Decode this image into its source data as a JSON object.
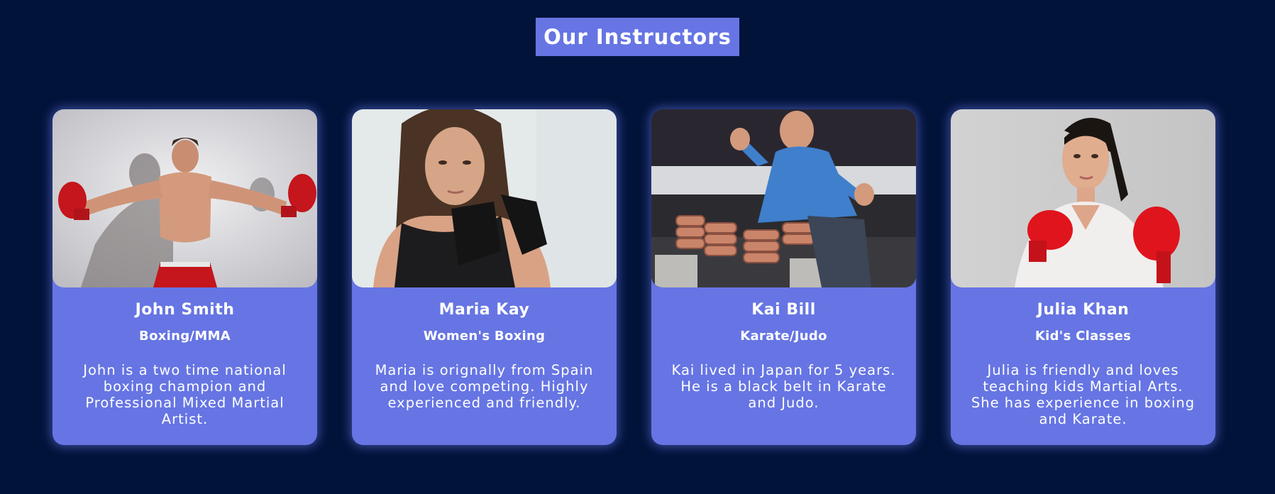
{
  "section": {
    "title": "Our Instructors"
  },
  "instructors": [
    {
      "name": "John Smith",
      "role": "Boxing/MMA",
      "bio": "John is a two time national boxing champion and Professional Mixed Martial Artist."
    },
    {
      "name": "Maria Kay",
      "role": "Women's Boxing",
      "bio": "Maria is orignally from Spain and love competing. Highly experienced and friendly."
    },
    {
      "name": "Kai Bill",
      "role": "Karate/Judo",
      "bio": "Kai lived in Japan for 5 years. He is a black belt in Karate and Judo."
    },
    {
      "name": "Julia Khan",
      "role": "Kid's Classes",
      "bio": "Julia is friendly and loves teaching kids Martial Arts. She has experience in boxing and Karate."
    }
  ],
  "colors": {
    "page_background": "#02133a",
    "accent": "#6675e3",
    "text": "#ffffff"
  }
}
